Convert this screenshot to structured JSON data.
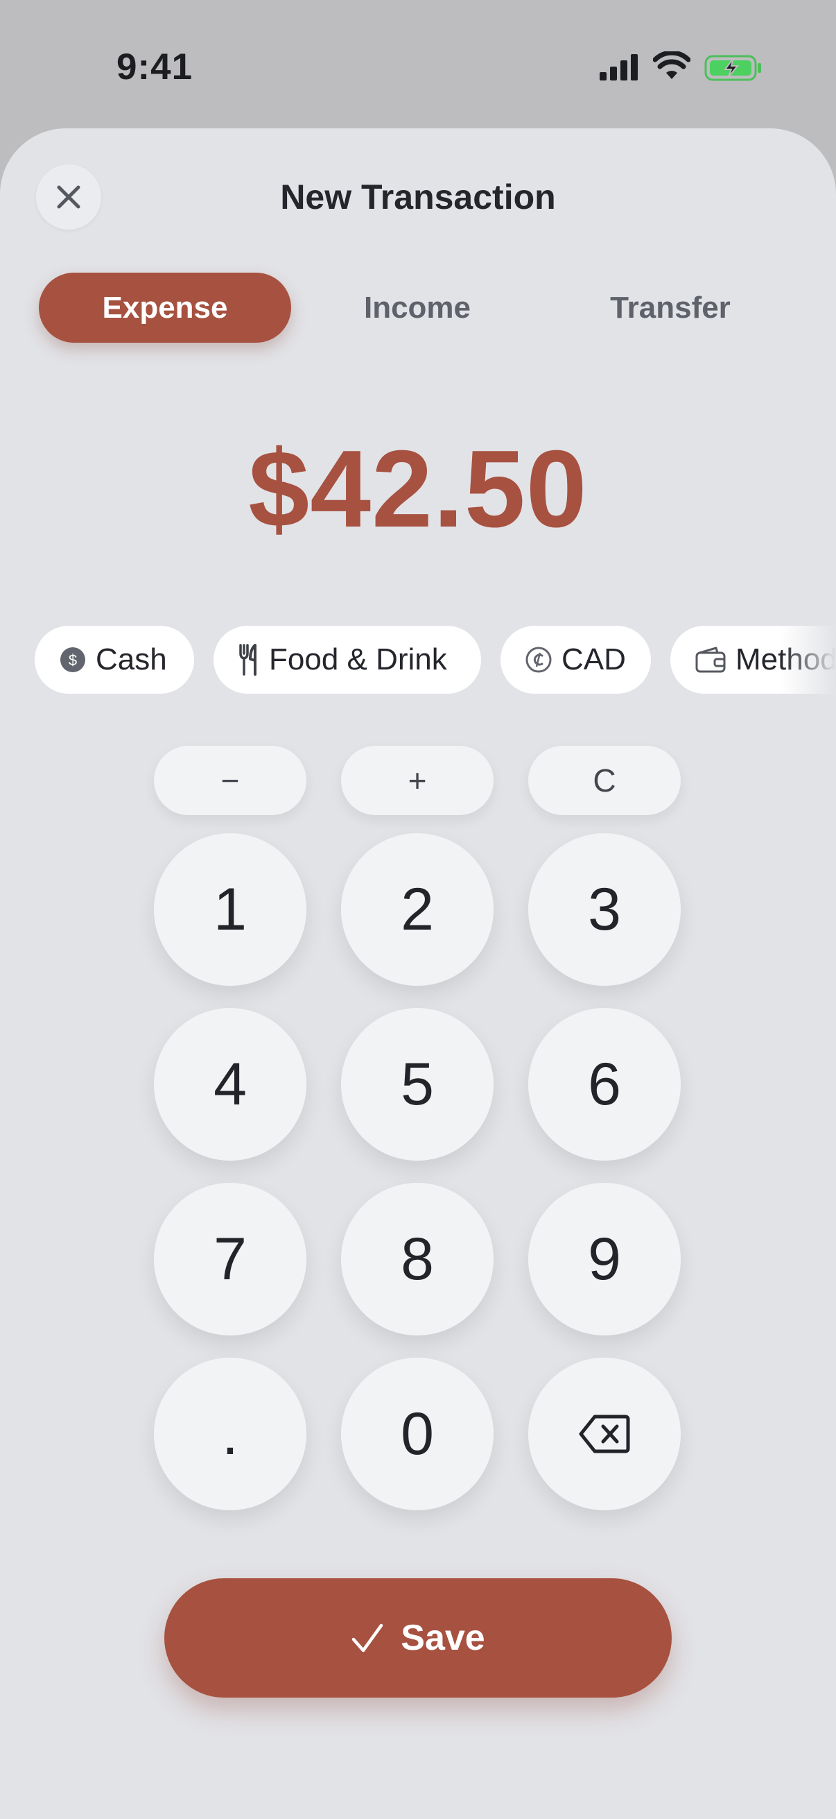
{
  "status_bar": {
    "time": "9:41"
  },
  "header": {
    "title": "New Transaction"
  },
  "tabs": [
    {
      "label": "Expense",
      "active": true
    },
    {
      "label": "Income",
      "active": false
    },
    {
      "label": "Transfer",
      "active": false
    }
  ],
  "amount": "$42.50",
  "chips": [
    {
      "label": "Cash",
      "icon": "dollar-circle-icon"
    },
    {
      "label": "Food & Drink",
      "icon": "fork-knife-icon"
    },
    {
      "label": "CAD",
      "icon": "currency-circle-icon"
    },
    {
      "label": "Method",
      "icon": "wallet-icon"
    }
  ],
  "operators": [
    "−",
    "+",
    "C"
  ],
  "keys": [
    "1",
    "2",
    "3",
    "4",
    "5",
    "6",
    "7",
    "8",
    "9",
    ".",
    "0"
  ],
  "save_label": "Save",
  "colors": {
    "accent": "#a75140",
    "sheet": "#e2e3e7",
    "key": "#f2f3f5"
  }
}
